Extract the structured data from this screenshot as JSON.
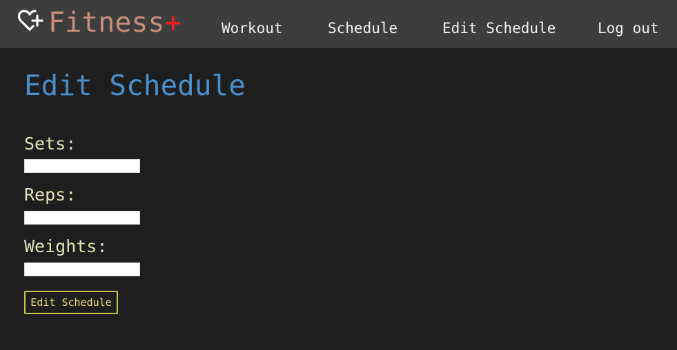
{
  "brand": {
    "name": "Fitness",
    "plus": "+",
    "icon": "heart-plus-icon",
    "name_color": "#c98f7b",
    "plus_color": "#ff1a1a"
  },
  "nav": {
    "workout": "Workout",
    "schedule": "Schedule",
    "edit_schedule": "Edit Schedule",
    "logout": "Log out"
  },
  "page": {
    "title": "Edit Schedule",
    "title_color": "#4a8fcb"
  },
  "form": {
    "sets": {
      "label": "Sets:",
      "value": ""
    },
    "reps": {
      "label": "Reps:",
      "value": ""
    },
    "weights": {
      "label": "Weights:",
      "value": ""
    },
    "submit_label": "Edit Schedule"
  },
  "colors": {
    "background": "#1e1e1e",
    "navbar": "#3d3d3d",
    "label": "#e2e2b8",
    "button_border": "#c9c44a"
  }
}
